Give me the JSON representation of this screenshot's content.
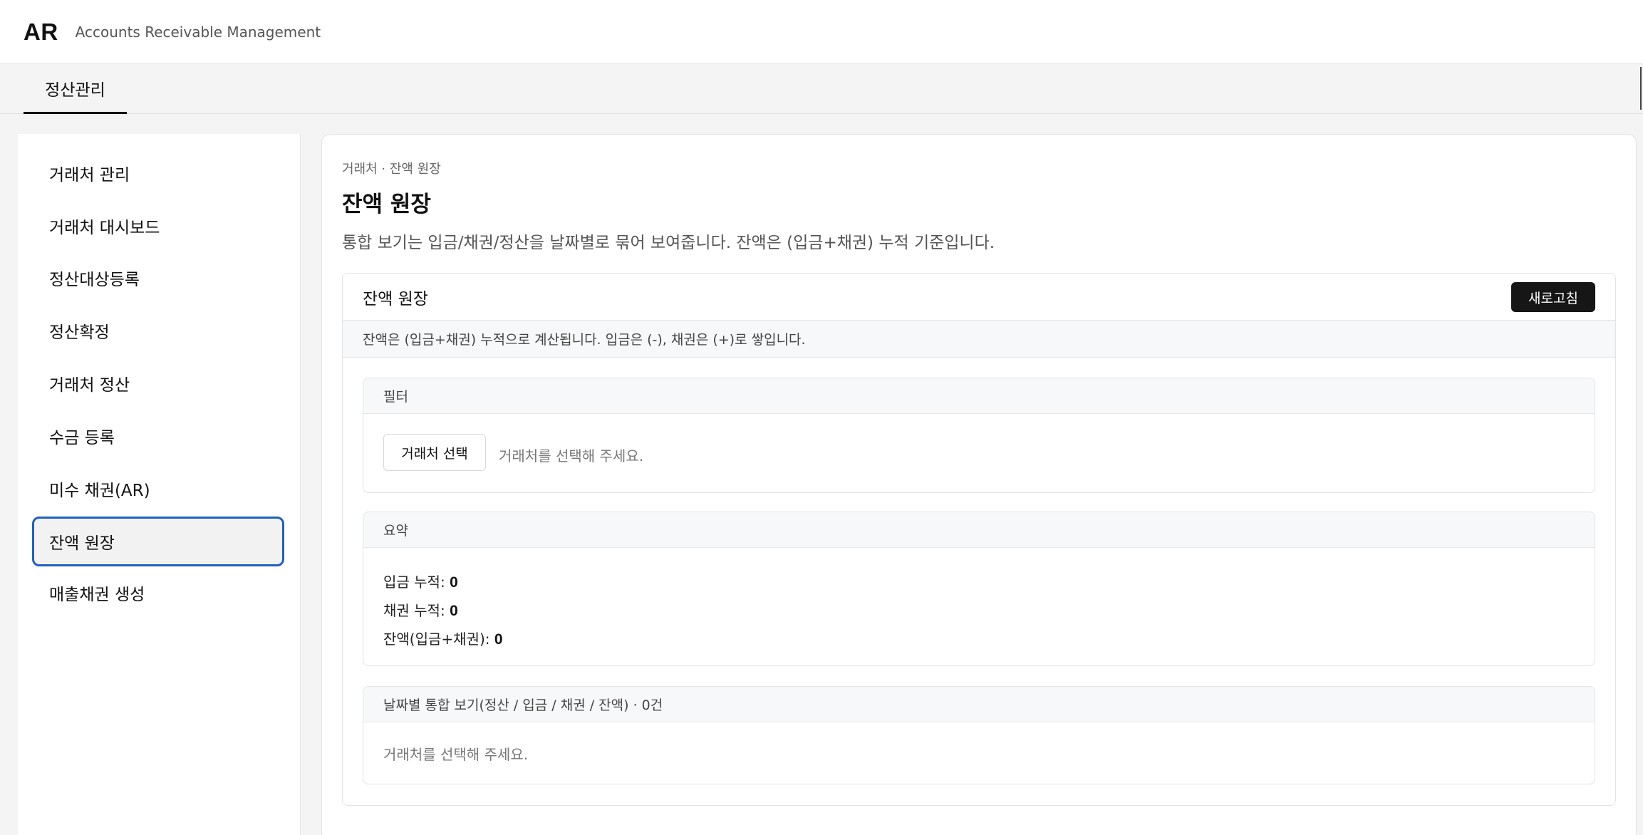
{
  "header": {
    "logo": "AR",
    "app_title": "Accounts Receivable Management"
  },
  "tabs": [
    {
      "label": "정산관리",
      "active": true
    }
  ],
  "sidebar": {
    "items": [
      {
        "label": "거래처 관리"
      },
      {
        "label": "거래처 대시보드"
      },
      {
        "label": "정산대상등록"
      },
      {
        "label": "정산확정"
      },
      {
        "label": "거래처 정산"
      },
      {
        "label": "수금 등록"
      },
      {
        "label": "미수 채권(AR)"
      },
      {
        "label": "잔액 원장",
        "active": true
      },
      {
        "label": "매출채권 생성"
      }
    ]
  },
  "main": {
    "breadcrumb": "거래처 · 잔액 원장",
    "title": "잔액 원장",
    "description": "통합 보기는 입금/채권/정산을 날짜별로 묶어 보여줍니다. 잔액은 (입금+채권) 누적 기준입니다.",
    "card": {
      "title": "잔액 원장",
      "refresh_label": "새로고침",
      "note": "잔액은 (입금+채권) 누적으로 계산됩니다. 입금은 (-), 채권은 (+)로 쌓입니다.",
      "filter": {
        "title": "필터",
        "select_label": "거래처 선택",
        "hint": "거래처를 선택해 주세요."
      },
      "summary": {
        "title": "요약",
        "deposit_label": "입금 누적: ",
        "deposit_value": "0",
        "receivable_label": "채권 누적: ",
        "receivable_value": "0",
        "balance_label": "잔액(입금+채권): ",
        "balance_value": "0"
      },
      "daily": {
        "title": "날짜별 통합 보기(정산 / 입금 / 채권 / 잔액) · 0건",
        "empty": "거래처를 선택해 주세요."
      }
    }
  },
  "colors": {
    "active_border": "#1f5fc2",
    "primary_button": "#161616"
  }
}
